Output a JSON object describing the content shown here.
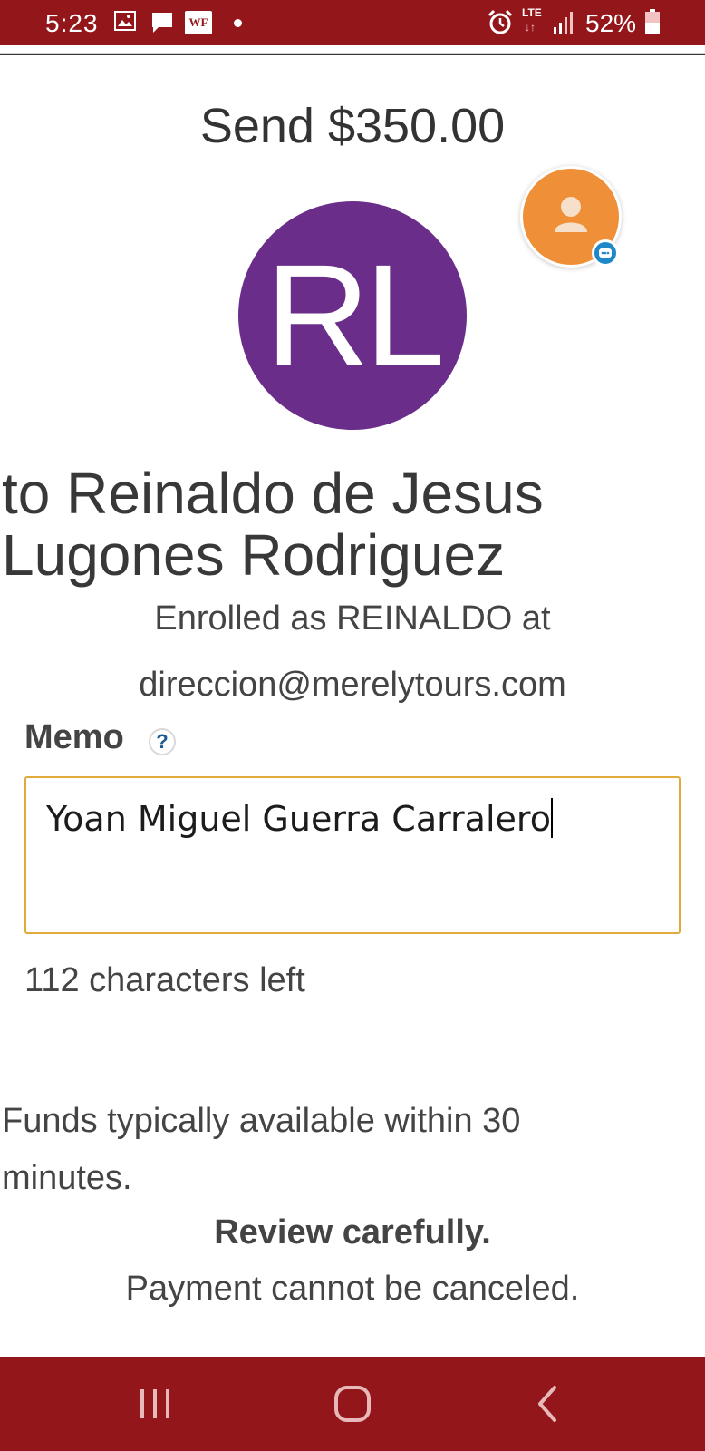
{
  "status_bar": {
    "time": "5:23",
    "wf_label": "WF",
    "lte_label": "LTE",
    "battery_percent": "52%",
    "icons": [
      "image-icon",
      "message-icon",
      "wf-icon",
      "notification-dot-icon",
      "alarm-icon",
      "lte-icon",
      "signal-icon",
      "battery-icon"
    ]
  },
  "header": {
    "title": "Send $350.00"
  },
  "recipient": {
    "initials": "RL",
    "avatar_color": "#6b2d8a",
    "name": "to Reinaldo de Jesus Lugones Rodriguez",
    "enrolled_line": "Enrolled as REINALDO at",
    "email": "direccion@merelytours.com"
  },
  "memo": {
    "label": "Memo",
    "help_glyph": "?",
    "value": "Yoan Miguel Guerra Carralero",
    "chars_left": "112 characters left"
  },
  "notice": {
    "funds": "Funds typically available within 30 minutes.",
    "review_title": "Review carefully.",
    "review_sub": "Payment cannot be canceled."
  },
  "chat_head": {
    "color": "#ef9039",
    "badge_color": "#1e88c9"
  },
  "colors": {
    "bars": "#93161b",
    "memo_border": "#e0ab3b"
  },
  "nav": {
    "buttons": [
      "recents-icon",
      "home-icon",
      "back-icon"
    ]
  }
}
